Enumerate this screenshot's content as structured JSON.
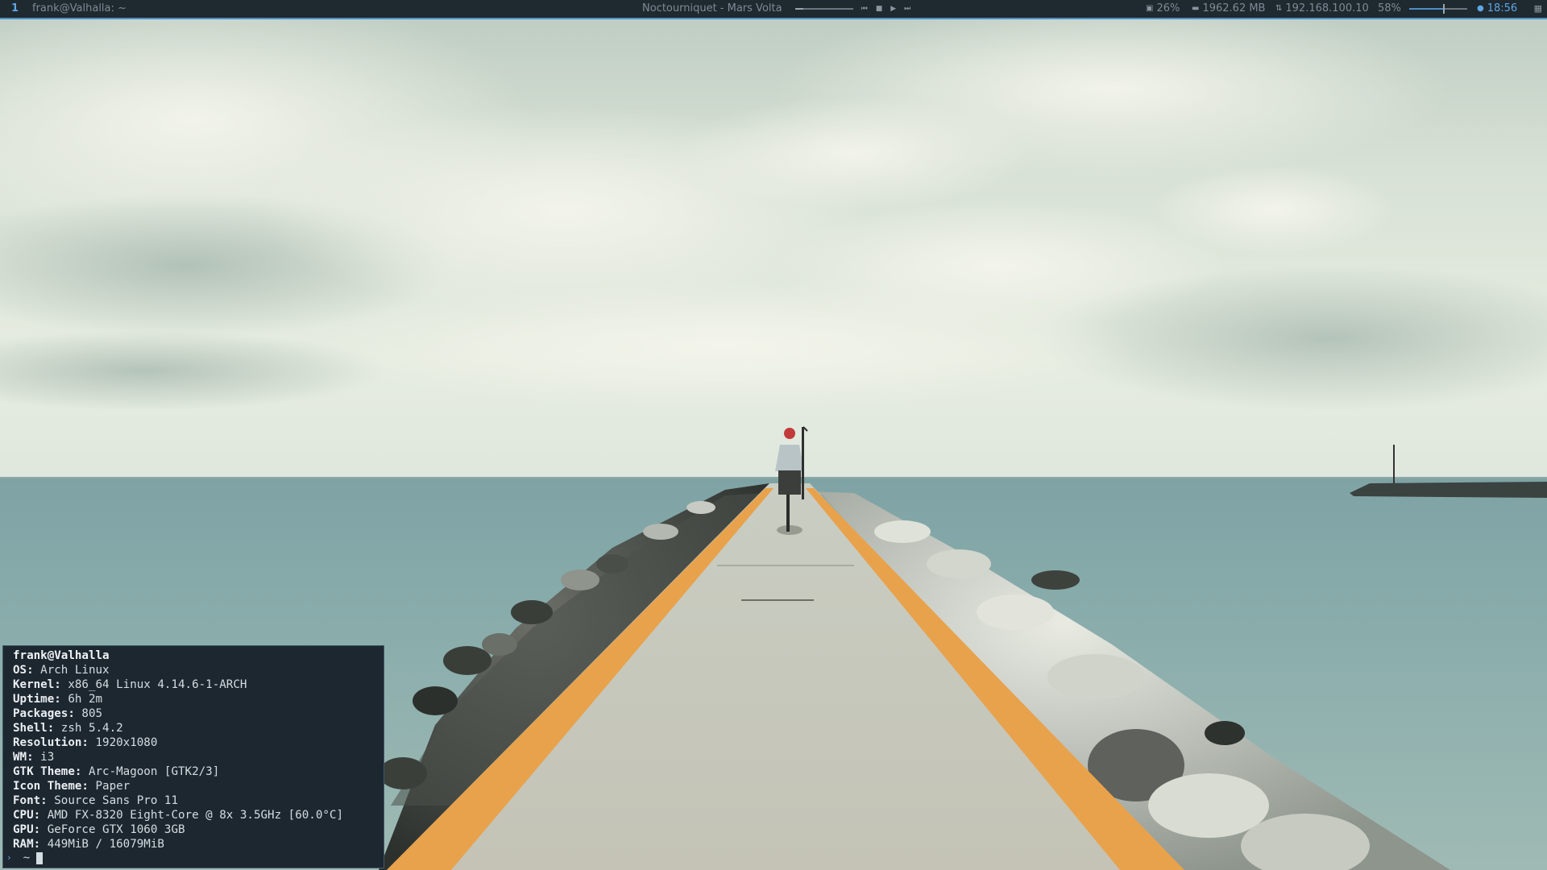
{
  "topbar": {
    "workspace": "1",
    "window_title": "frank@Valhalla: ~",
    "now_playing": "Noctourniquet - Mars Volta",
    "cpu": "26%",
    "memory": "1962.62 MB",
    "ip": "192.168.100.10",
    "volume": "58%",
    "volume_level": 0.58,
    "time": "18:56",
    "icons": {
      "cpu": "cpu-icon",
      "memory": "memory-icon",
      "network": "network-icon",
      "clock": "clock-icon",
      "tray": "calendar-icon"
    },
    "colors": {
      "accent": "#5fa6e3",
      "bar_bg": "#1f2930",
      "bar_border": "#4a90c8"
    }
  },
  "terminal": {
    "user_host": "frank@Valhalla",
    "info": [
      {
        "key": "OS:",
        "value": " Arch Linux"
      },
      {
        "key": "Kernel:",
        "value": " x86_64 Linux 4.14.6-1-ARCH"
      },
      {
        "key": "Uptime:",
        "value": " 6h 2m"
      },
      {
        "key": "Packages:",
        "value": " 805"
      },
      {
        "key": "Shell:",
        "value": " zsh 5.4.2"
      },
      {
        "key": "Resolution:",
        "value": " 1920x1080"
      },
      {
        "key": "WM:",
        "value": " i3"
      },
      {
        "key": "GTK Theme:",
        "value": " Arc-Magoon [GTK2/3]"
      },
      {
        "key": "Icon Theme:",
        "value": " Paper"
      },
      {
        "key": "Font:",
        "value": " Source Sans Pro 11"
      },
      {
        "key": "CPU:",
        "value": " AMD FX-8320 Eight-Core @ 8x 3.5GHz [60.0°C]"
      },
      {
        "key": "GPU:",
        "value": " GeForce GTX 1060 3GB"
      },
      {
        "key": "RAM:",
        "value": " 449MiB / 16079MiB"
      }
    ],
    "prompt_arrow": "›",
    "prompt_dir": "~"
  }
}
